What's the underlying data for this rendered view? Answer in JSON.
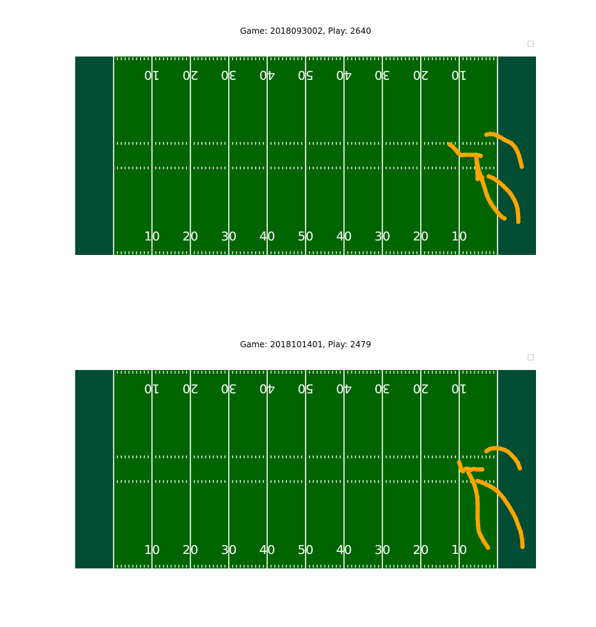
{
  "colors": {
    "field": "#006400",
    "endzone": "#004d33",
    "lines": "#ffffff",
    "route": "#ffa500"
  },
  "chart_data": [
    {
      "type": "scatter",
      "title": "Game: 2018093002, Play: 2640",
      "xlim": [
        0,
        120
      ],
      "ylim": [
        0,
        53.3
      ],
      "grid": false,
      "legend": "top-right (empty)",
      "yard_numbers": [
        "10",
        "20",
        "30",
        "40",
        "50",
        "40",
        "30",
        "20",
        "10"
      ],
      "series": [
        {
          "x": [
            97.5,
            98.3,
            99.1,
            99.8,
            100.6,
            101.5,
            102.4,
            103.3,
            104.2,
            105.0,
            105.6
          ],
          "y": [
            29.7,
            29.1,
            28.2,
            27.3,
            26.8,
            26.9,
            26.9,
            26.9,
            26.9,
            26.8,
            26.6
          ]
        },
        {
          "x": [
            104.4,
            104.5,
            104.6,
            104.7,
            104.8,
            105.3,
            105.8,
            106.0
          ],
          "y": [
            26.9,
            25.8,
            24.6,
            23.4,
            20.4,
            20.7,
            20.8,
            20.8
          ]
        },
        {
          "x": [
            107.1,
            108.1,
            109.0,
            110.0,
            110.9,
            111.8,
            112.7,
            113.6,
            114.6,
            115.2,
            115.6,
            115.9,
            116.3
          ],
          "y": [
            32.3,
            32.5,
            32.4,
            32.0,
            31.5,
            30.9,
            30.5,
            30.0,
            28.9,
            27.7,
            26.6,
            25.4,
            23.7
          ]
        },
        {
          "x": [
            107.7,
            108.9,
            110.4,
            111.5,
            112.4,
            113.3,
            113.9,
            114.5,
            114.9,
            115.2,
            115.3,
            115.4,
            115.4
          ],
          "y": [
            21.1,
            20.6,
            19.5,
            18.5,
            17.6,
            16.6,
            15.6,
            14.5,
            13.5,
            12.4,
            11.2,
            10.0,
            8.9
          ]
        },
        {
          "x": [
            104.6,
            105.0,
            105.5,
            106.0,
            106.4,
            106.8,
            107.2,
            107.7,
            108.3,
            109.1,
            110.0,
            111.1,
            111.8
          ],
          "y": [
            25.2,
            23.0,
            21.5,
            20.0,
            18.7,
            17.4,
            16.1,
            14.9,
            13.8,
            12.6,
            11.4,
            10.2,
            9.8
          ]
        }
      ]
    },
    {
      "type": "scatter",
      "title": "Game: 2018101401, Play: 2479",
      "xlim": [
        0,
        120
      ],
      "ylim": [
        0,
        53.3
      ],
      "grid": false,
      "legend": "top-right (empty)",
      "yard_numbers": [
        "10",
        "20",
        "30",
        "40",
        "50",
        "40",
        "30",
        "20",
        "10"
      ],
      "series": [
        {
          "x": [
            100.0,
            100.2,
            100.4,
            100.6,
            101.0,
            101.5,
            102.0,
            102.5,
            103.0,
            103.7,
            104.5,
            105.3,
            106.0
          ],
          "y": [
            28.5,
            27.9,
            27.2,
            26.4,
            26.1,
            26.6,
            26.8,
            26.7,
            26.5,
            26.7,
            26.6,
            26.6,
            26.6
          ]
        },
        {
          "x": [
            102.4,
            102.9,
            103.5,
            104.0,
            104.4,
            104.7,
            104.8,
            104.8,
            104.8,
            104.9,
            105.1,
            105.7,
            106.4,
            107.5
          ],
          "y": [
            25.8,
            24.8,
            23.6,
            22.3,
            20.8,
            19.2,
            17.4,
            15.4,
            13.4,
            11.6,
            10.0,
            8.6,
            7.3,
            5.6
          ]
        },
        {
          "x": [
            107.1,
            108.0,
            109.0,
            110.0,
            111.0,
            111.9,
            112.8,
            113.6,
            114.5,
            115.3,
            115.8
          ],
          "y": [
            31.5,
            32.1,
            32.3,
            32.3,
            32.1,
            31.8,
            31.3,
            30.5,
            29.5,
            28.3,
            26.9
          ]
        },
        {
          "x": [
            104.8,
            105.9,
            107.0,
            108.0,
            109.0,
            110.0,
            110.8,
            111.6,
            112.4,
            113.2,
            114.0,
            114.7,
            115.3,
            116.0,
            116.4,
            116.5
          ],
          "y": [
            23.5,
            23.1,
            22.6,
            22.1,
            21.5,
            20.7,
            19.8,
            18.8,
            17.6,
            16.3,
            14.9,
            13.5,
            11.8,
            9.9,
            7.7,
            5.8
          ]
        }
      ]
    }
  ]
}
